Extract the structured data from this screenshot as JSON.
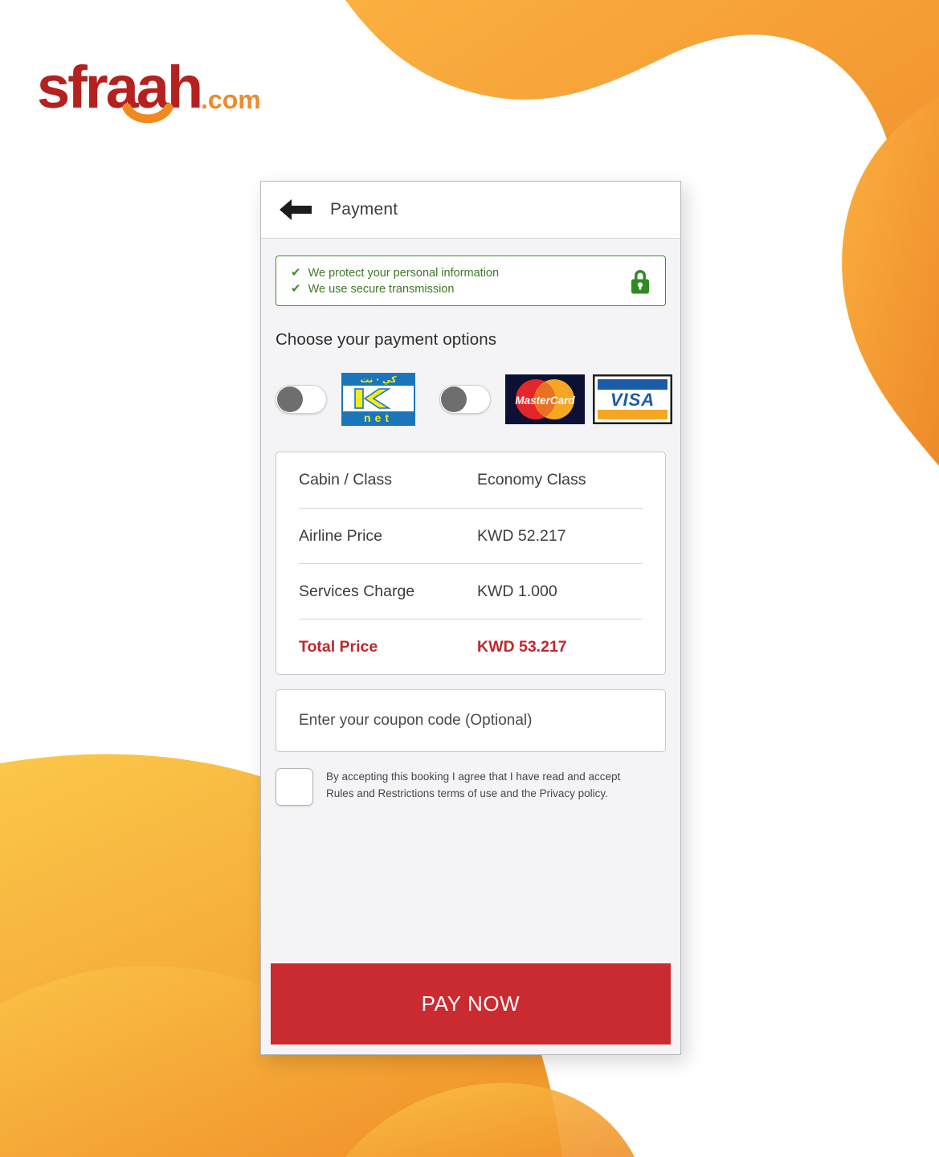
{
  "brand": {
    "logo_wordmark": "sfraah",
    "logo_tld": ".com",
    "wordmark_color": "#b5211f",
    "tld_color": "#ef8a2d",
    "smile_color": "#f08a1e"
  },
  "background": {
    "blob_top_color_start": "#fbb040",
    "blob_top_color_end": "#ef8c2a",
    "blob_bottom_color_start": "#fbc74a",
    "blob_bottom_color_end": "#f29a2e"
  },
  "app_bar": {
    "back_icon": "arrow-left-icon",
    "title": "Payment"
  },
  "security": {
    "lines": [
      "We protect your personal information",
      "We use secure transmission"
    ],
    "check_glyph": "✔",
    "lock_icon": "lock-icon",
    "accent_color": "#3e8f28"
  },
  "payment": {
    "heading": "Choose your payment options",
    "options": [
      {
        "name": "knet",
        "toggle_state": "off",
        "logo_label": "KNET",
        "logo_arabic": "كي · نت",
        "logo_sub": "n e t"
      },
      {
        "name": "credit-card",
        "toggle_state": "off",
        "logo_label": "MasterCard",
        "logo_label2": "VISA"
      }
    ]
  },
  "price_table": {
    "rows": [
      {
        "label": "Cabin / Class",
        "value": "Economy Class",
        "highlight": false
      },
      {
        "label": "Airline Price",
        "value": "KWD 52.217",
        "highlight": false
      },
      {
        "label": "Services Charge",
        "value": "KWD 1.000",
        "highlight": false
      },
      {
        "label": "Total Price",
        "value": "KWD 53.217",
        "highlight": true
      }
    ],
    "total_color": "#c0272d"
  },
  "coupon": {
    "placeholder": "Enter your coupon code (Optional)",
    "value": ""
  },
  "terms": {
    "checked": false,
    "text": "By accepting this booking I agree that I have read and accept Rules and Restrictions terms of use and the Privacy policy."
  },
  "actions": {
    "pay_now_label": "PAY NOW",
    "pay_now_color": "#c92b30"
  }
}
